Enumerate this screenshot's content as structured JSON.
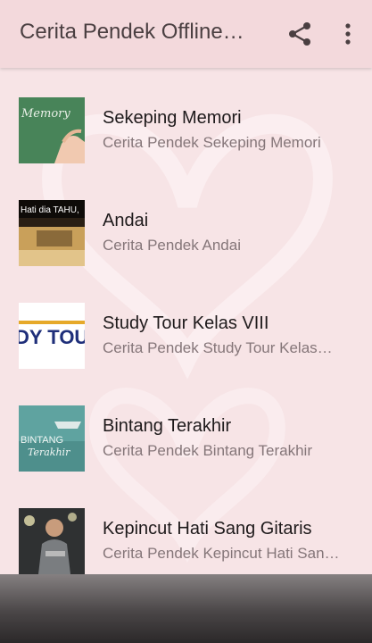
{
  "app_bar": {
    "title": "Cerita Pendek Offline…",
    "share_icon": "share-icon",
    "more_icon": "more-vert-icon"
  },
  "thumbnail_captions": {
    "memory_board": "Memory",
    "andai_banner": "Hati dia TAHU,",
    "study_tour_banner": "DY TOU",
    "bintang_text_1": "BINTANG",
    "bintang_text_2": "Terakhir"
  },
  "items": [
    {
      "title": "Sekeping Memori",
      "subtitle": "Cerita Pendek Sekeping Memori"
    },
    {
      "title": "Andai",
      "subtitle": "Cerita Pendek Andai"
    },
    {
      "title": "Study Tour Kelas VIII",
      "subtitle": "Cerita Pendek Study Tour Kelas…"
    },
    {
      "title": "Bintang Terakhir",
      "subtitle": "Cerita Pendek Bintang Terakhir"
    },
    {
      "title": "Kepincut Hati Sang Gitaris",
      "subtitle": "Cerita Pendek Kepincut Hati San…"
    }
  ]
}
